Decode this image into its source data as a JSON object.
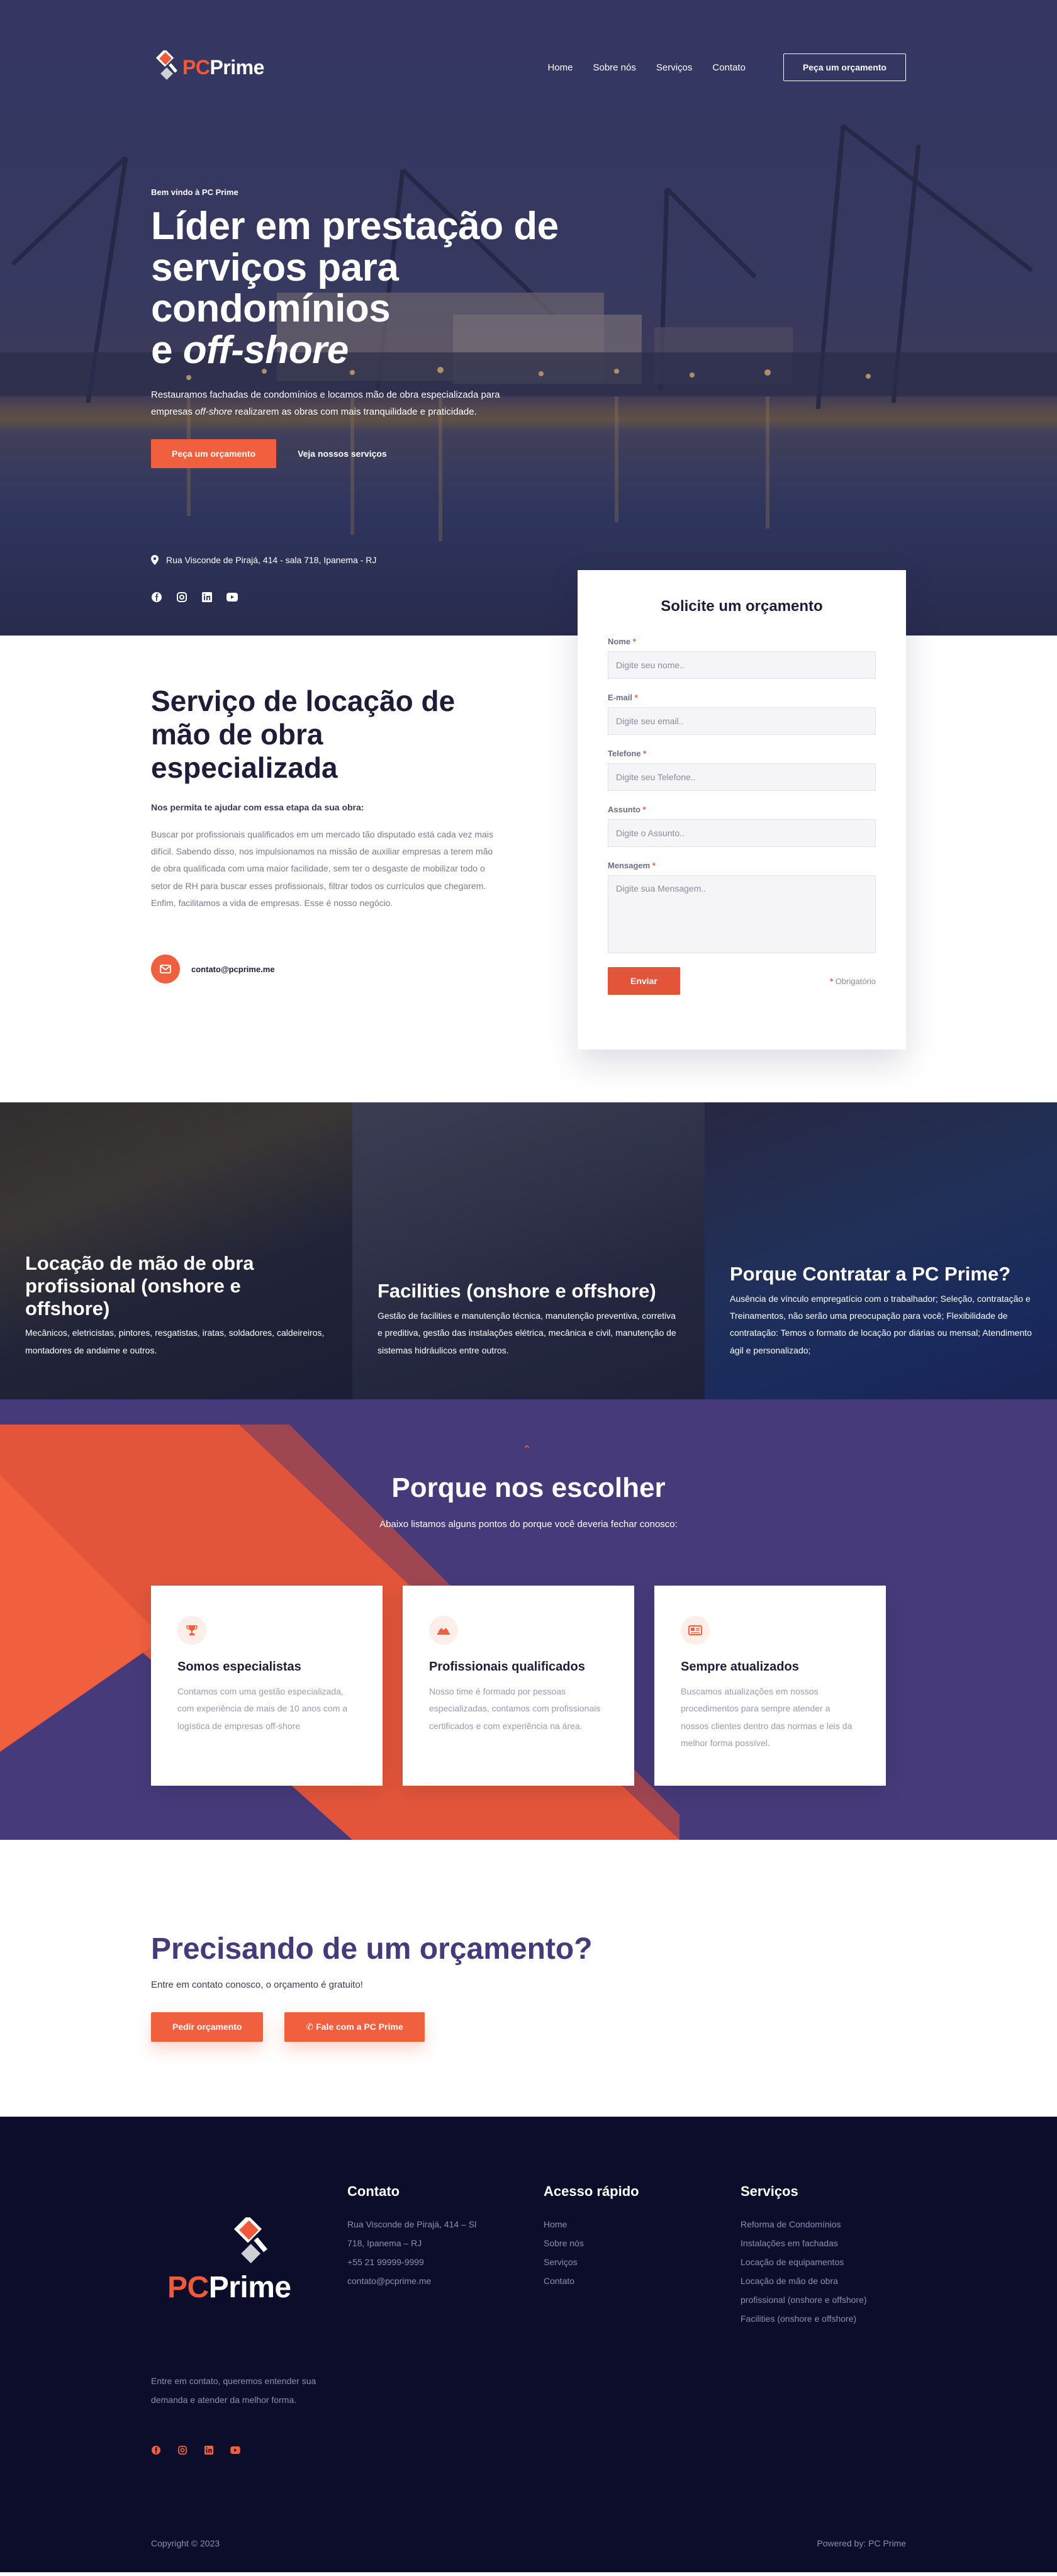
{
  "brand": {
    "pc": "PC",
    "name": "Prime",
    "accent": "#f0603f",
    "primary": "#463a7a",
    "dark": "#0b0d2b"
  },
  "nav": {
    "items": [
      "Home",
      "Sobre nós",
      "Serviços",
      "Contato"
    ],
    "cta": "Peça um orçamento"
  },
  "hero": {
    "kicker": "Bem vindo à PC Prime",
    "title_line1": "Líder em prestação de",
    "title_line2": "serviços para condomínios",
    "title_line3_prefix": "e ",
    "title_line3_em": "off-shore",
    "text_part1": "Restauramos fachadas de condomínios e locamos mão de obra especializada para empresas ",
    "text_em": "off-shore",
    "text_part2": " realizarem as obras com mais tranquilidade e praticidade.",
    "btn_primary": "Peça um orçamento",
    "btn_secondary": "Veja nossos serviços",
    "address": "Rua Visconde de Pirajá, 414 - sala 718, Ipanema - RJ",
    "social": [
      "facebook-icon",
      "instagram-icon",
      "linkedin-icon",
      "youtube-icon"
    ]
  },
  "form": {
    "title": "Solicite um orçamento",
    "fields": [
      {
        "label": "Nome",
        "req": "*",
        "placeholder": "Digite seu nome.."
      },
      {
        "label": "E-mail",
        "req": "*",
        "placeholder": "Digite seu email.."
      },
      {
        "label": "Telefone",
        "req": "*",
        "placeholder": "Digite seu Telefone.."
      },
      {
        "label": "Assunto",
        "req": "*",
        "placeholder": "Digite o Assunto.."
      },
      {
        "label": "Mensagem",
        "req": "*",
        "placeholder": "Digite sua Mensagem.."
      }
    ],
    "submit": "Enviar",
    "required_mark": "*",
    "required_note": "Obrigatório"
  },
  "about": {
    "title": "Serviço de locação de mão de obra especializada",
    "subtitle": "Nos permita te ajudar com essa etapa da sua obra:",
    "text": "Buscar por profissionais qualificados em um mercado tão disputado está cada vez mais difícil. Sabendo disso, nos impulsionamos na missão de auxiliar empresas a terem mão de obra qualificada com uma maior facilidade, sem ter o desgaste de mobilizar todo o setor de RH para buscar esses profissionais, filtrar todos os currículos que chegarem. Enfim, facilitamos a vida de empresas. Esse é nosso negócio.",
    "email": "contato@pcprime.me"
  },
  "panels": [
    {
      "title": "Locação de mão de obra profissional (onshore e offshore)",
      "text": "Mecânicos, eletricistas, pintores, resgatistas, iratas, soldadores, caldeireiros, montadores de andaime e outros."
    },
    {
      "title": "Facilities (onshore e offshore)",
      "text": "Gestão de facilities e manutenção técnica, manutenção preventiva, corretiva e preditiva, gestão das instalações elétrica, mecânica e civil, manutenção de sistemas hidráulicos entre outros."
    },
    {
      "title": "Porque Contratar a PC Prime?",
      "text": "Ausência de vínculo empregatício com o trabalhador; Seleção, contratação e Treinamentos, não serão uma preocupação para você; Flexibilidade de contratação: Temos o formato de locação por diárias ou mensal; Atendimento ágil e personalizado;"
    }
  ],
  "why": {
    "title": "Porque nos escolher",
    "subtitle": "Abaixo listamos alguns pontos do porque você deveria fechar conosco:",
    "cards": [
      {
        "icon": "trophy-icon",
        "title": "Somos especialistas",
        "text": "Contamos com uma gestão especializada, com experiência de mais de 10 anos com a logística de empresas off-shore"
      },
      {
        "icon": "hard-hat-icon",
        "title": "Profissionais qualificados",
        "text": "Nosso time é formado por pessoas especializadas, contamos com profissionais certificados e com experiência na área."
      },
      {
        "icon": "newspaper-icon",
        "title": "Sempre atualizados",
        "text": "Buscamos atualizações em nossos procedimentos para sempre atender a nossos clientes dentro das normas e leis da melhor forma possível."
      }
    ]
  },
  "cta": {
    "title": "Precisando de um orçamento?",
    "subtitle": "Entre em contato conosco, o orçamento é gratuito!",
    "btn1": "Pedir orçamento",
    "btn2": "Fale com a PC Prime"
  },
  "footer": {
    "contact_title": "Contato",
    "contact": [
      "Rua Visconde de Pirajá, 414 – Sl",
      "718, Ipanema – RJ",
      "+55 21 99999-9999",
      "contato@pcprime.me"
    ],
    "quick_title": "Acesso rápido",
    "quick": [
      "Home",
      "Sobre nós",
      "Serviços",
      "Contato"
    ],
    "services_title": "Serviços",
    "services": [
      "Reforma de Condomínios",
      "Instalações em fachadas",
      "Locação de equipamentos",
      "Locação de mão de obra",
      "profissional (onshore e offshore)",
      "Facilities (onshore e offshore)"
    ],
    "about": "Entre em contato, queremos entender sua demanda e atender da melhor forma.",
    "copyright": "Copyright © 2023",
    "powered": "Powered by: PC Prime"
  }
}
